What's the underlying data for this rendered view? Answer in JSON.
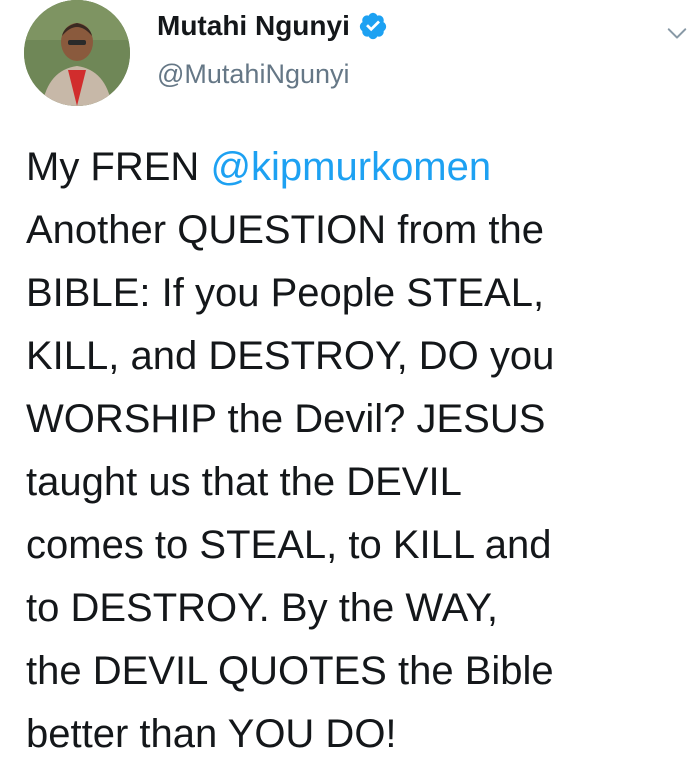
{
  "author": {
    "display_name": "Mutahi Ngunyi",
    "handle": "@MutahiNgunyi",
    "verified": true,
    "avatar_icon": "profile-photo"
  },
  "tweet": {
    "prefix": "My FREN ",
    "mention": "@kipmurkomen",
    "body": "\nAnother QUESTION from the\nBIBLE: If you People STEAL,\nKILL, and DESTROY, DO you\nWORSHIP the Devil? JESUS\ntaught us that the DEVIL\ncomes to STEAL, to KILL and\nto DESTROY. By the WAY,\nthe DEVIL QUOTES the Bible\nbetter than YOU DO!"
  },
  "icons": {
    "verified": "verified-badge-icon",
    "menu": "chevron-down-icon"
  },
  "colors": {
    "accent": "#1da1f2",
    "text": "#14171a",
    "secondary": "#657786"
  }
}
